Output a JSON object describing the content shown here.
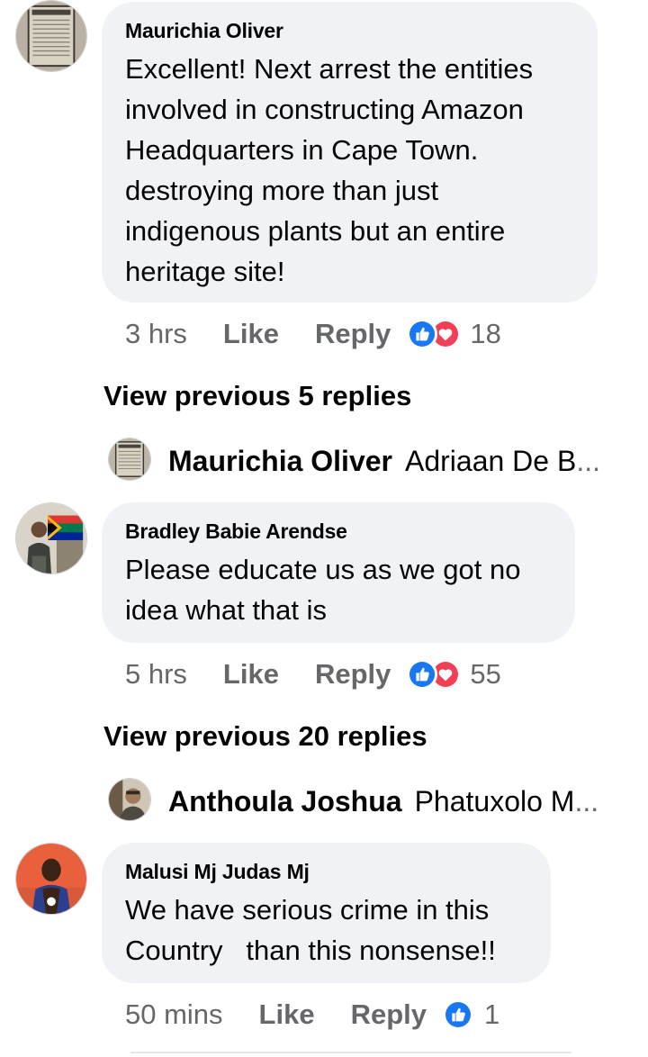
{
  "comments": [
    {
      "author": "Maurichia Oliver",
      "text_lines": [
        "Excellent! Next arrest the entities",
        "involved in constructing  Amazon",
        "Headquarters in Cape Town.",
        "destroying more than just",
        "indigenous plants but an entire",
        "heritage site!"
      ],
      "time": "3 hrs",
      "like_label": "Like",
      "reply_label": "Reply",
      "reaction_count": "18",
      "view_previous": "View previous 5 replies",
      "latest_reply": {
        "name": "Maurichia Oliver",
        "text": "Adriaan De B",
        "ellipsis": "..."
      }
    },
    {
      "author": "Bradley Babie Arendse",
      "text_lines": [
        "Please educate us as we got no",
        "idea what that is"
      ],
      "time": "5 hrs",
      "like_label": "Like",
      "reply_label": "Reply",
      "reaction_count": "55",
      "view_previous": "View previous 20 replies",
      "latest_reply": {
        "name": "Anthoula Joshua",
        "text": "Phatuxolo M",
        "ellipsis": "..."
      }
    },
    {
      "author": "Malusi Mj Judas Mj",
      "text_lines": [
        "We have serious crime in this",
        "Country   than this nonsense!!"
      ],
      "time": "50 mins",
      "like_label": "Like",
      "reply_label": "Reply",
      "reaction_count": "1"
    }
  ],
  "colors": {
    "bubble": "#f0f2f5",
    "like_blue": "#1877f2",
    "love_red": "#f33e58",
    "meta_gray": "#65676b"
  },
  "icons": [
    "like-reaction-icon",
    "love-reaction-icon"
  ]
}
